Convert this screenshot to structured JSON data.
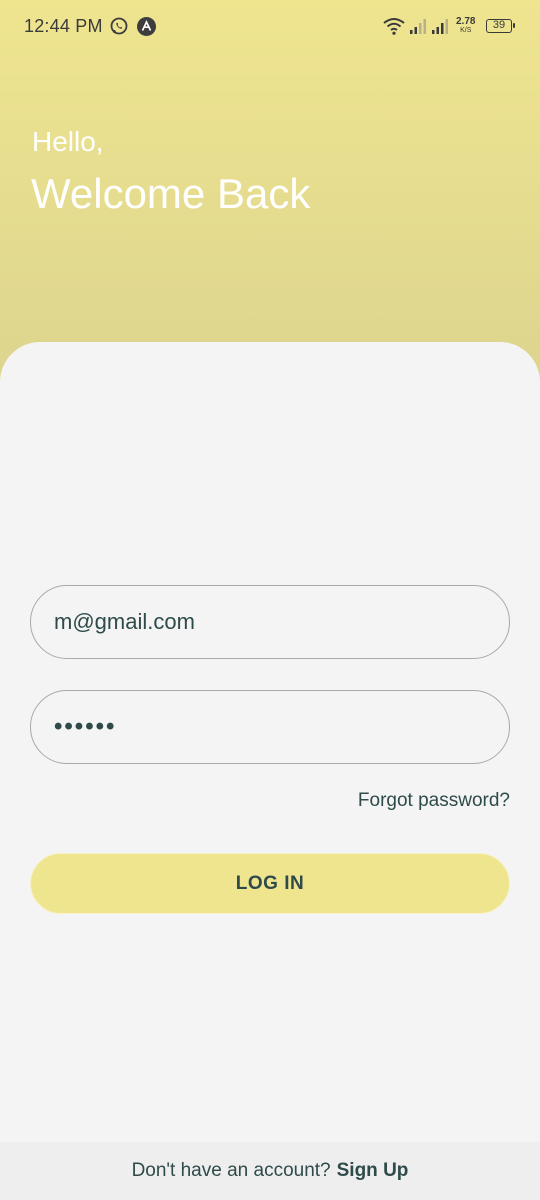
{
  "status_bar": {
    "time": "12:44 PM",
    "network_speed_value": "2.78",
    "network_speed_unit": "K/S",
    "battery_level": "39",
    "icons": [
      "whatsapp-icon",
      "app-notification-icon",
      "wifi-icon",
      "signal-icon",
      "signal-icon",
      "battery-icon"
    ]
  },
  "header": {
    "greeting": "Hello,",
    "title": "Welcome Back"
  },
  "form": {
    "email_value": "m@gmail.com",
    "password_value": "••••••",
    "forgot_password_label": "Forgot password?",
    "login_button_label": "LOG IN"
  },
  "footer": {
    "prompt_text": "Don't have an account?",
    "signup_link_label": "Sign Up"
  },
  "colors": {
    "header_yellow": "#efe58f",
    "text_dark_teal": "#2f4a4a",
    "background": "#f4f4f4"
  }
}
